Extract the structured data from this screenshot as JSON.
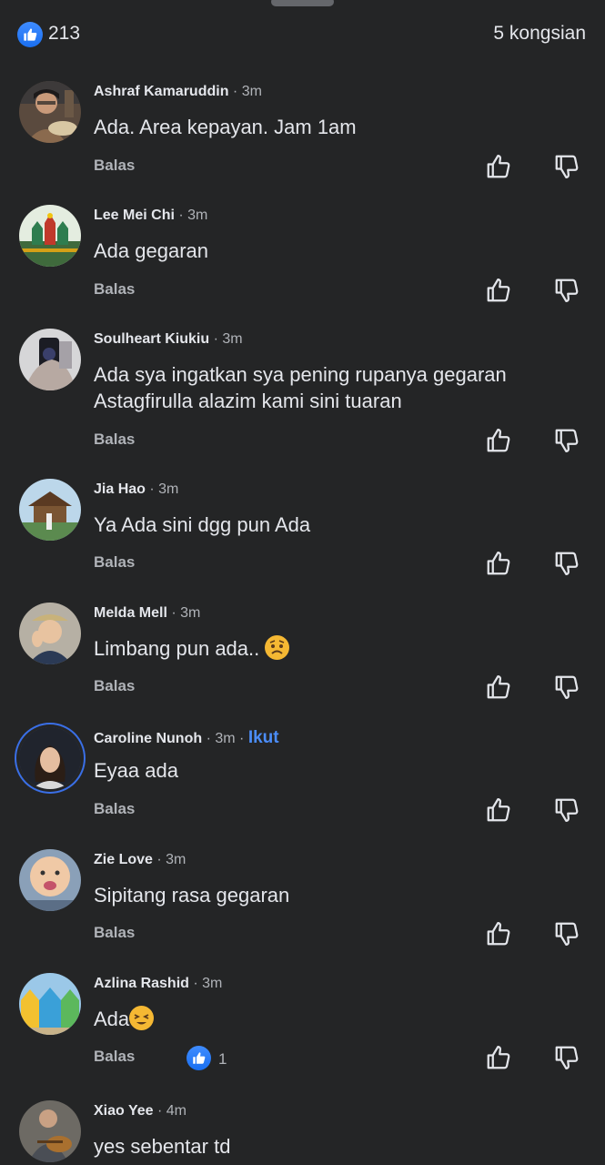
{
  "header": {
    "like_count": "213",
    "shares": "5 kongsian"
  },
  "reply_label": "Balas",
  "comments": [
    {
      "name": "Ashraf Kamaruddin",
      "time": "3m",
      "text": "Ada. Area kepayan. Jam 1am"
    },
    {
      "name": "Lee Mei Chi",
      "time": "3m",
      "text": "Ada gegaran"
    },
    {
      "name": "Soulheart Kiukiu",
      "time": "3m",
      "text": "Ada sya ingatkan sya pening rupanya gegaran Astagfirulla alazim kami sini tuaran"
    },
    {
      "name": "Jia Hao",
      "time": "3m",
      "text": "Ya Ada sini dgg pun Ada"
    },
    {
      "name": "Melda Mell",
      "time": "3m",
      "text": "Limbang pun ada.."
    },
    {
      "name": "Caroline Nunoh",
      "time": "3m",
      "follow": "Ikut",
      "text": "Eyaa ada"
    },
    {
      "name": "Zie Love",
      "time": "3m",
      "text": "Sipitang rasa gegaran"
    },
    {
      "name": "Azlina Rashid",
      "time": "3m",
      "text": "Ada",
      "reactions": "1"
    },
    {
      "name": "Xiao Yee",
      "time": "4m",
      "text": "yes sebentar td"
    }
  ]
}
